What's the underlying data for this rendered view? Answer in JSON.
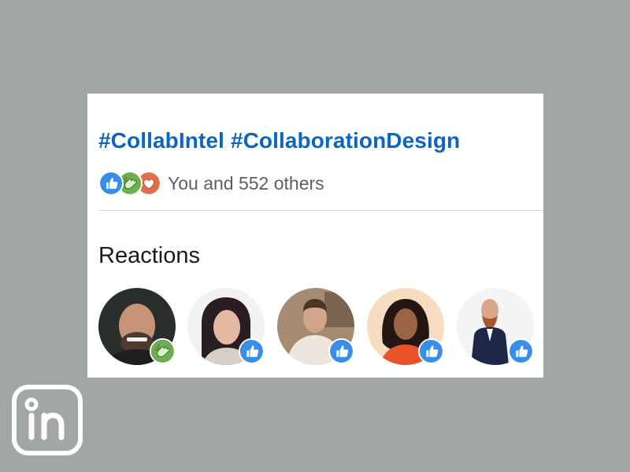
{
  "post": {
    "hashtags": [
      "#CollabIntel",
      "#CollaborationDesign"
    ],
    "reaction_icons": [
      "like-icon",
      "celebrate-icon",
      "love-icon"
    ],
    "reaction_summary": "You and 552 others"
  },
  "reactions_section": {
    "title": "Reactions",
    "reactors": [
      {
        "reaction": "celebrate-icon"
      },
      {
        "reaction": "like-icon"
      },
      {
        "reaction": "like-icon"
      },
      {
        "reaction": "like-icon"
      },
      {
        "reaction": "like-icon"
      }
    ]
  },
  "brand": {
    "logo": "linkedin-logo-icon"
  },
  "colors": {
    "link": "#0a66c2",
    "like": "#378fe9",
    "celebrate": "#44712e",
    "love": "#df704d",
    "background": "#a2a6a6"
  }
}
